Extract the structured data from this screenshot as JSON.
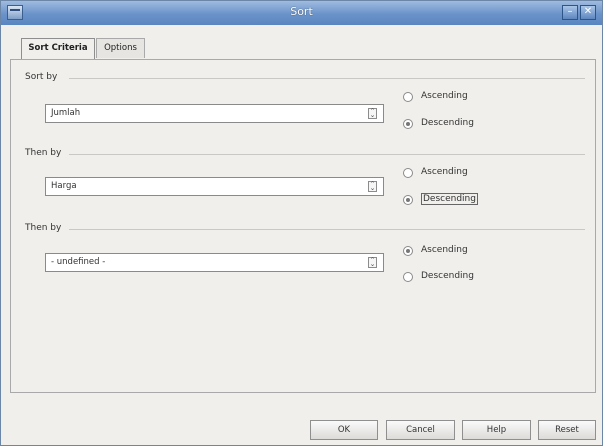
{
  "window": {
    "title": "Sort"
  },
  "tabs": [
    {
      "label": "Sort Criteria",
      "active": true
    },
    {
      "label": "Options",
      "active": false
    }
  ],
  "groups": [
    {
      "label": "Sort by",
      "selected": "Jumlah",
      "options": [
        "Ascending",
        "Descending"
      ],
      "checked": "Descending"
    },
    {
      "label": "Then by",
      "selected": "Harga",
      "options": [
        "Ascending",
        "Descending"
      ],
      "checked": "Descending"
    },
    {
      "label": "Then by",
      "selected": "- undefined -",
      "options": [
        "Ascending",
        "Descending"
      ],
      "checked": "Ascending"
    }
  ],
  "buttons": {
    "ok": "OK",
    "cancel": "Cancel",
    "help": "Help",
    "reset": "Reset"
  }
}
